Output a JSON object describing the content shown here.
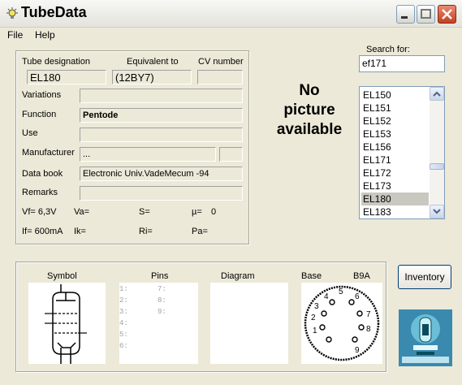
{
  "window": {
    "title": "TubeData"
  },
  "menu": {
    "file": "File",
    "help": "Help"
  },
  "form": {
    "tube_designation_label": "Tube designation",
    "tube_designation": "EL180",
    "equivalent_label": "Equivalent to",
    "equivalent": "(12BY7)",
    "cv_label": "CV number",
    "cv": "",
    "variations_label": "Variations",
    "variations": "",
    "function_label": "Function",
    "function": "Pentode",
    "use_label": "Use",
    "use": "",
    "manufacturer_label": "Manufacturer",
    "manufacturer": "...",
    "manufacturer_code": "",
    "databook_label": "Data book",
    "databook": "Electronic Univ.VadeMecum -94",
    "remarks_label": "Remarks",
    "remarks": ""
  },
  "params": {
    "vf": "Vf= 6,3V",
    "va": "Va=",
    "s": "S=",
    "mu": "µ=",
    "mu_val": "0",
    "if": "If= 600mA",
    "ik": "Ik=",
    "ri": "Ri=",
    "pa": "Pa="
  },
  "picture": {
    "line1": "No",
    "line2": "picture",
    "line3": "available"
  },
  "search": {
    "label": "Search for:",
    "value": "ef171"
  },
  "list": {
    "items": [
      "EL150",
      "EL151",
      "EL152",
      "EL153",
      "EL156",
      "EL171",
      "EL172",
      "EL173",
      "EL180",
      "EL183"
    ],
    "selected": "EL180"
  },
  "bottom": {
    "symbol_label": "Symbol",
    "pins_label": "Pins",
    "diagram_label": "Diagram",
    "base_label": "Base",
    "base_type": "B9A",
    "pins": [
      "1:",
      "2:",
      "3:",
      "4:",
      "5:",
      "6:",
      "7:",
      "8:",
      "9:"
    ],
    "base_pin_numbers": [
      "1",
      "2",
      "3",
      "4",
      "5",
      "6",
      "7",
      "8",
      "9"
    ]
  },
  "inventory": {
    "label": "Inventory"
  },
  "icons": {
    "app": "lightbulb-icon",
    "minimize": "minimize-icon",
    "maximize": "maximize-icon",
    "close": "close-icon"
  }
}
